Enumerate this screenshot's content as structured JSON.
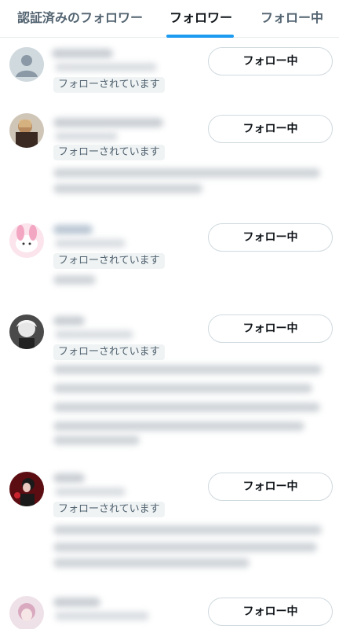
{
  "tabs": [
    {
      "label": "認証済みのフォロワー",
      "active": false
    },
    {
      "label": "フォロワー",
      "active": true
    },
    {
      "label": "フォロー中",
      "active": false
    }
  ],
  "accent_color": "#1d9bf0",
  "followers": [
    {
      "avatar": "default-avatar-icon",
      "badge": "フォローされています",
      "button": "フォロー中"
    },
    {
      "avatar": "avatar-photo",
      "badge": "フォローされています",
      "button": "フォロー中"
    },
    {
      "avatar": "avatar-photo",
      "badge": "フォローされています",
      "button": "フォロー中"
    },
    {
      "avatar": "avatar-photo",
      "badge": "フォローされています",
      "button": "フォロー中"
    },
    {
      "avatar": "avatar-photo",
      "badge": "フォローされています",
      "button": "フォロー中"
    },
    {
      "avatar": "avatar-photo",
      "badge": "",
      "button": "フォロー中"
    }
  ]
}
